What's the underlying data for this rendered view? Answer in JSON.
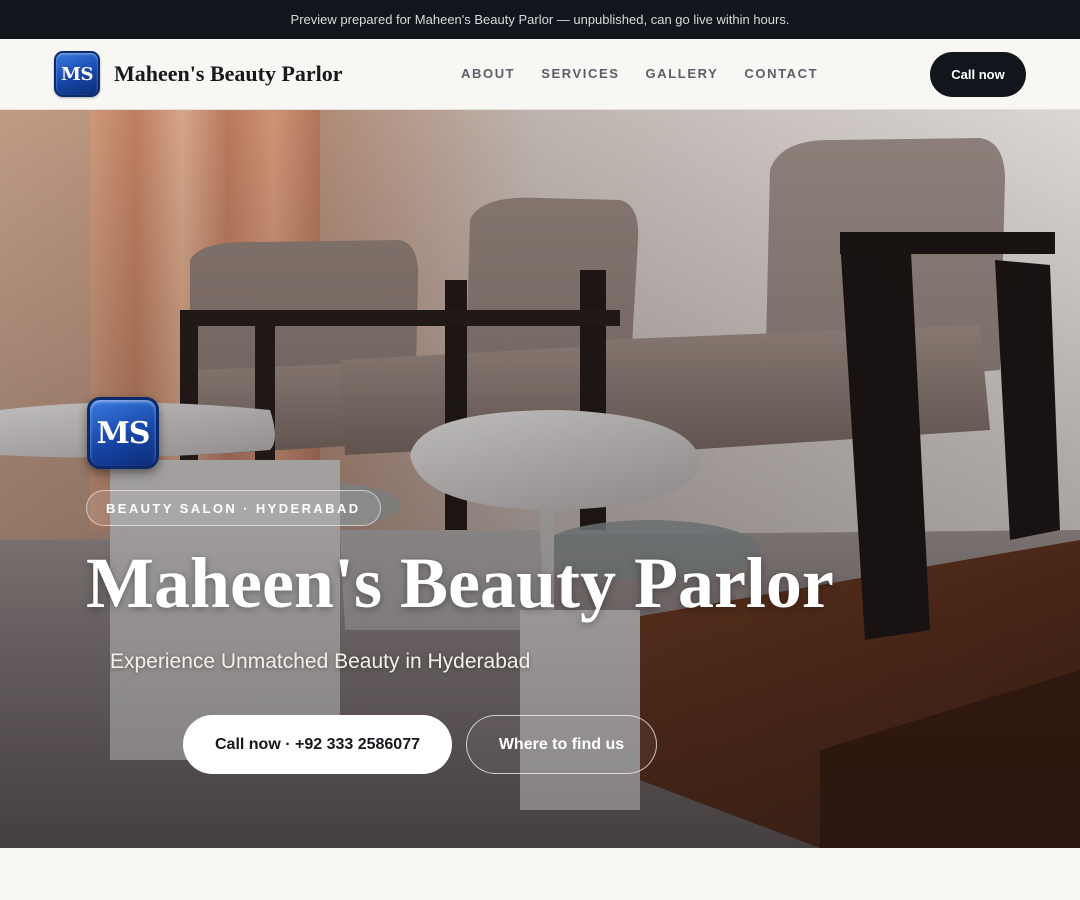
{
  "banner": {
    "text": "Preview prepared for Maheen's Beauty Parlor — unpublished, can go live within hours."
  },
  "header": {
    "logo_text": "MS",
    "brand_name": "Maheen's Beauty Parlor",
    "nav": [
      "ABOUT",
      "SERVICES",
      "GALLERY",
      "CONTACT"
    ],
    "cta_label": "Call now"
  },
  "hero": {
    "logo_text": "MS",
    "tagline_pill": "BEAUTY SALON · HYDERABAD",
    "title": "Maheen's Beauty Parlor",
    "subtitle": "Experience Unmatched Beauty in Hyderabad",
    "primary_button": "Call now · +92 333 2586077",
    "secondary_button": "Where to find us"
  },
  "colors": {
    "dark": "#12151b",
    "page_bg": "#f8f7f4",
    "logo_blue": "#1646a8"
  }
}
